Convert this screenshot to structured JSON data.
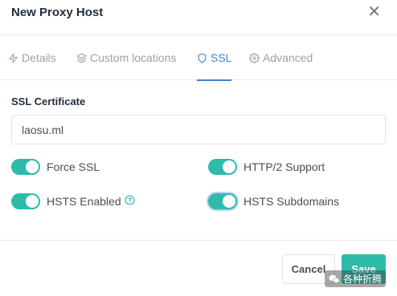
{
  "modal": {
    "title": "New Proxy Host",
    "close_glyph": "✕"
  },
  "tabs": [
    {
      "label": "Details",
      "icon": "zap-icon",
      "active": false
    },
    {
      "label": "Custom locations",
      "icon": "layers-icon",
      "active": false
    },
    {
      "label": "SSL",
      "icon": "shield-icon",
      "active": true
    },
    {
      "label": "Advanced",
      "icon": "gear-icon",
      "active": false
    }
  ],
  "ssl": {
    "certificate_label": "SSL Certificate",
    "certificate_value": "laosu.ml",
    "toggles": {
      "force_ssl": {
        "label": "Force SSL",
        "on": true
      },
      "http2": {
        "label": "HTTP/2 Support",
        "on": true
      },
      "hsts": {
        "label": "HSTS Enabled",
        "on": true
      },
      "hsts_subdomains": {
        "label": "HSTS Subdomains",
        "on": true
      }
    }
  },
  "footer": {
    "cancel_label": "Cancel",
    "save_label": "Save"
  },
  "watermark": {
    "text": "各种折腾"
  },
  "colors": {
    "accent": "#2dbcaa",
    "tab_active": "#467fcf",
    "muted": "#9aa0ac"
  }
}
